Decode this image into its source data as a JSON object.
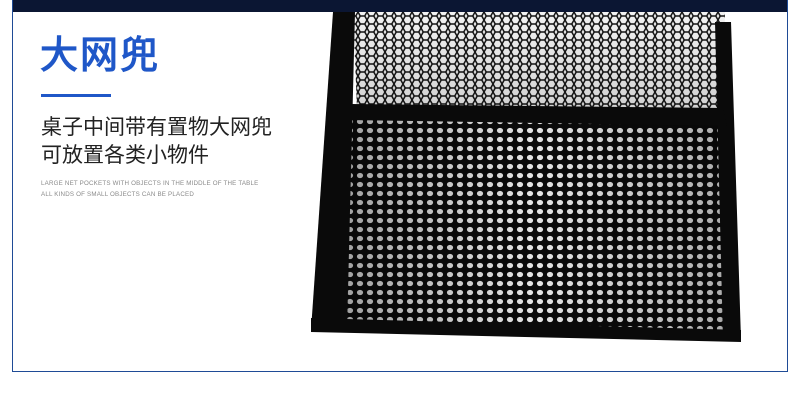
{
  "heading": "大网兜",
  "description": [
    "桌子中间带有置物大网兜",
    "可放置各类小物件"
  ],
  "english_caption": [
    "LARGE NET POCKETS WITH OBJECTS IN THE MIDDLE OF THE TABLE",
    "ALL KINDS OF SMALL OBJECTS CAN BE PLACED"
  ],
  "colors": {
    "accent": "#1f57c8",
    "border": "#1f4b96",
    "binding": "#0a0a0a",
    "table_top": "#0b1633"
  }
}
